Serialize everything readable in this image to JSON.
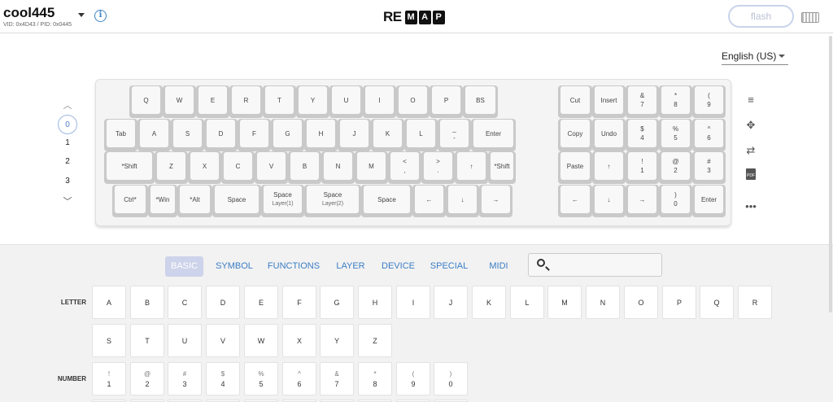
{
  "header": {
    "keyboard_name": "cool445",
    "ids": "VID: 0x4D43 / PID: 0x0445",
    "logo_re": "RE",
    "logo_boxes": [
      "M",
      "A",
      "P"
    ],
    "flash_label": "flash"
  },
  "language": "English (US)",
  "layers": [
    "0",
    "1",
    "2",
    "3"
  ],
  "active_layer": "0",
  "keyboard": {
    "left": [
      [
        {
          "l": "Q"
        },
        {
          "l": "W"
        },
        {
          "l": "E"
        },
        {
          "l": "R"
        },
        {
          "l": "T"
        },
        {
          "l": "Y"
        },
        {
          "l": "U"
        },
        {
          "l": "I"
        },
        {
          "l": "O"
        },
        {
          "l": "P"
        },
        {
          "l": "BS"
        }
      ],
      [
        {
          "l": "Tab"
        },
        {
          "l": "A"
        },
        {
          "l": "S"
        },
        {
          "l": "D"
        },
        {
          "l": "F"
        },
        {
          "l": "G"
        },
        {
          "l": "H"
        },
        {
          "l": "J"
        },
        {
          "l": "K"
        },
        {
          "l": "L"
        },
        {
          "u": "_",
          "l": "-"
        },
        {
          "l": "Enter"
        }
      ],
      [
        {
          "l": "*Shift"
        },
        {
          "l": "Z"
        },
        {
          "l": "X"
        },
        {
          "l": "C"
        },
        {
          "l": "V"
        },
        {
          "l": "B"
        },
        {
          "l": "N"
        },
        {
          "l": "M"
        },
        {
          "u": "<",
          "l": ","
        },
        {
          "u": ">",
          "l": "."
        },
        {
          "l": "↑"
        },
        {
          "l": "*Shift"
        }
      ],
      [
        {
          "l": "Ctrl*"
        },
        {
          "l": "*Win"
        },
        {
          "l": "*Alt"
        },
        {
          "l": "Space"
        },
        {
          "l": "Space",
          "s": "Layer(1)"
        },
        {
          "l": "Space",
          "s": "Layer(2)"
        },
        {
          "l": "Space"
        },
        {
          "l": "←"
        },
        {
          "l": "↓"
        },
        {
          "l": "→"
        }
      ]
    ],
    "right": [
      [
        {
          "l": "Cut"
        },
        {
          "l": "Insert"
        },
        {
          "u": "&",
          "l": "7"
        },
        {
          "u": "*",
          "l": "8"
        },
        {
          "u": "(",
          "l": "9"
        }
      ],
      [
        {
          "l": "Copy"
        },
        {
          "l": "Undo"
        },
        {
          "u": "$",
          "l": "4"
        },
        {
          "u": "%",
          "l": "5"
        },
        {
          "u": "^",
          "l": "6"
        }
      ],
      [
        {
          "l": "Paste"
        },
        {
          "l": "↑"
        },
        {
          "u": "!",
          "l": "1"
        },
        {
          "u": "@",
          "l": "2"
        },
        {
          "u": "#",
          "l": "3"
        }
      ],
      [
        {
          "l": "←"
        },
        {
          "l": "↓"
        },
        {
          "l": "→"
        },
        {
          "u": ")",
          "l": "0"
        },
        {
          "l": "Enter"
        }
      ]
    ]
  },
  "tabs": [
    "BASIC",
    "SYMBOL",
    "FUNCTIONS",
    "LAYER",
    "DEVICE",
    "SPECIAL",
    "MIDI"
  ],
  "active_tab": "BASIC",
  "search": {
    "placeholder": ""
  },
  "palette": {
    "letter_label": "LETTER",
    "letters": [
      "A",
      "B",
      "C",
      "D",
      "E",
      "F",
      "G",
      "H",
      "I",
      "J",
      "K",
      "L",
      "M",
      "N",
      "O",
      "P",
      "Q",
      "R",
      "S",
      "T",
      "U",
      "V",
      "W",
      "X",
      "Y",
      "Z"
    ],
    "number_label": "NUMBER",
    "numbers": [
      {
        "u": "!",
        "l": "1"
      },
      {
        "u": "@",
        "l": "2"
      },
      {
        "u": "#",
        "l": "3"
      },
      {
        "u": "$",
        "l": "4"
      },
      {
        "u": "%",
        "l": "5"
      },
      {
        "u": "^",
        "l": "6"
      },
      {
        "u": "&",
        "l": "7"
      },
      {
        "u": "*",
        "l": "8"
      },
      {
        "u": "(",
        "l": "9"
      },
      {
        "u": ")",
        "l": "0"
      }
    ]
  },
  "toolbar_icons": [
    "menu-icon",
    "target-icon",
    "swap-icon",
    "pdf-icon",
    "more-icon"
  ]
}
